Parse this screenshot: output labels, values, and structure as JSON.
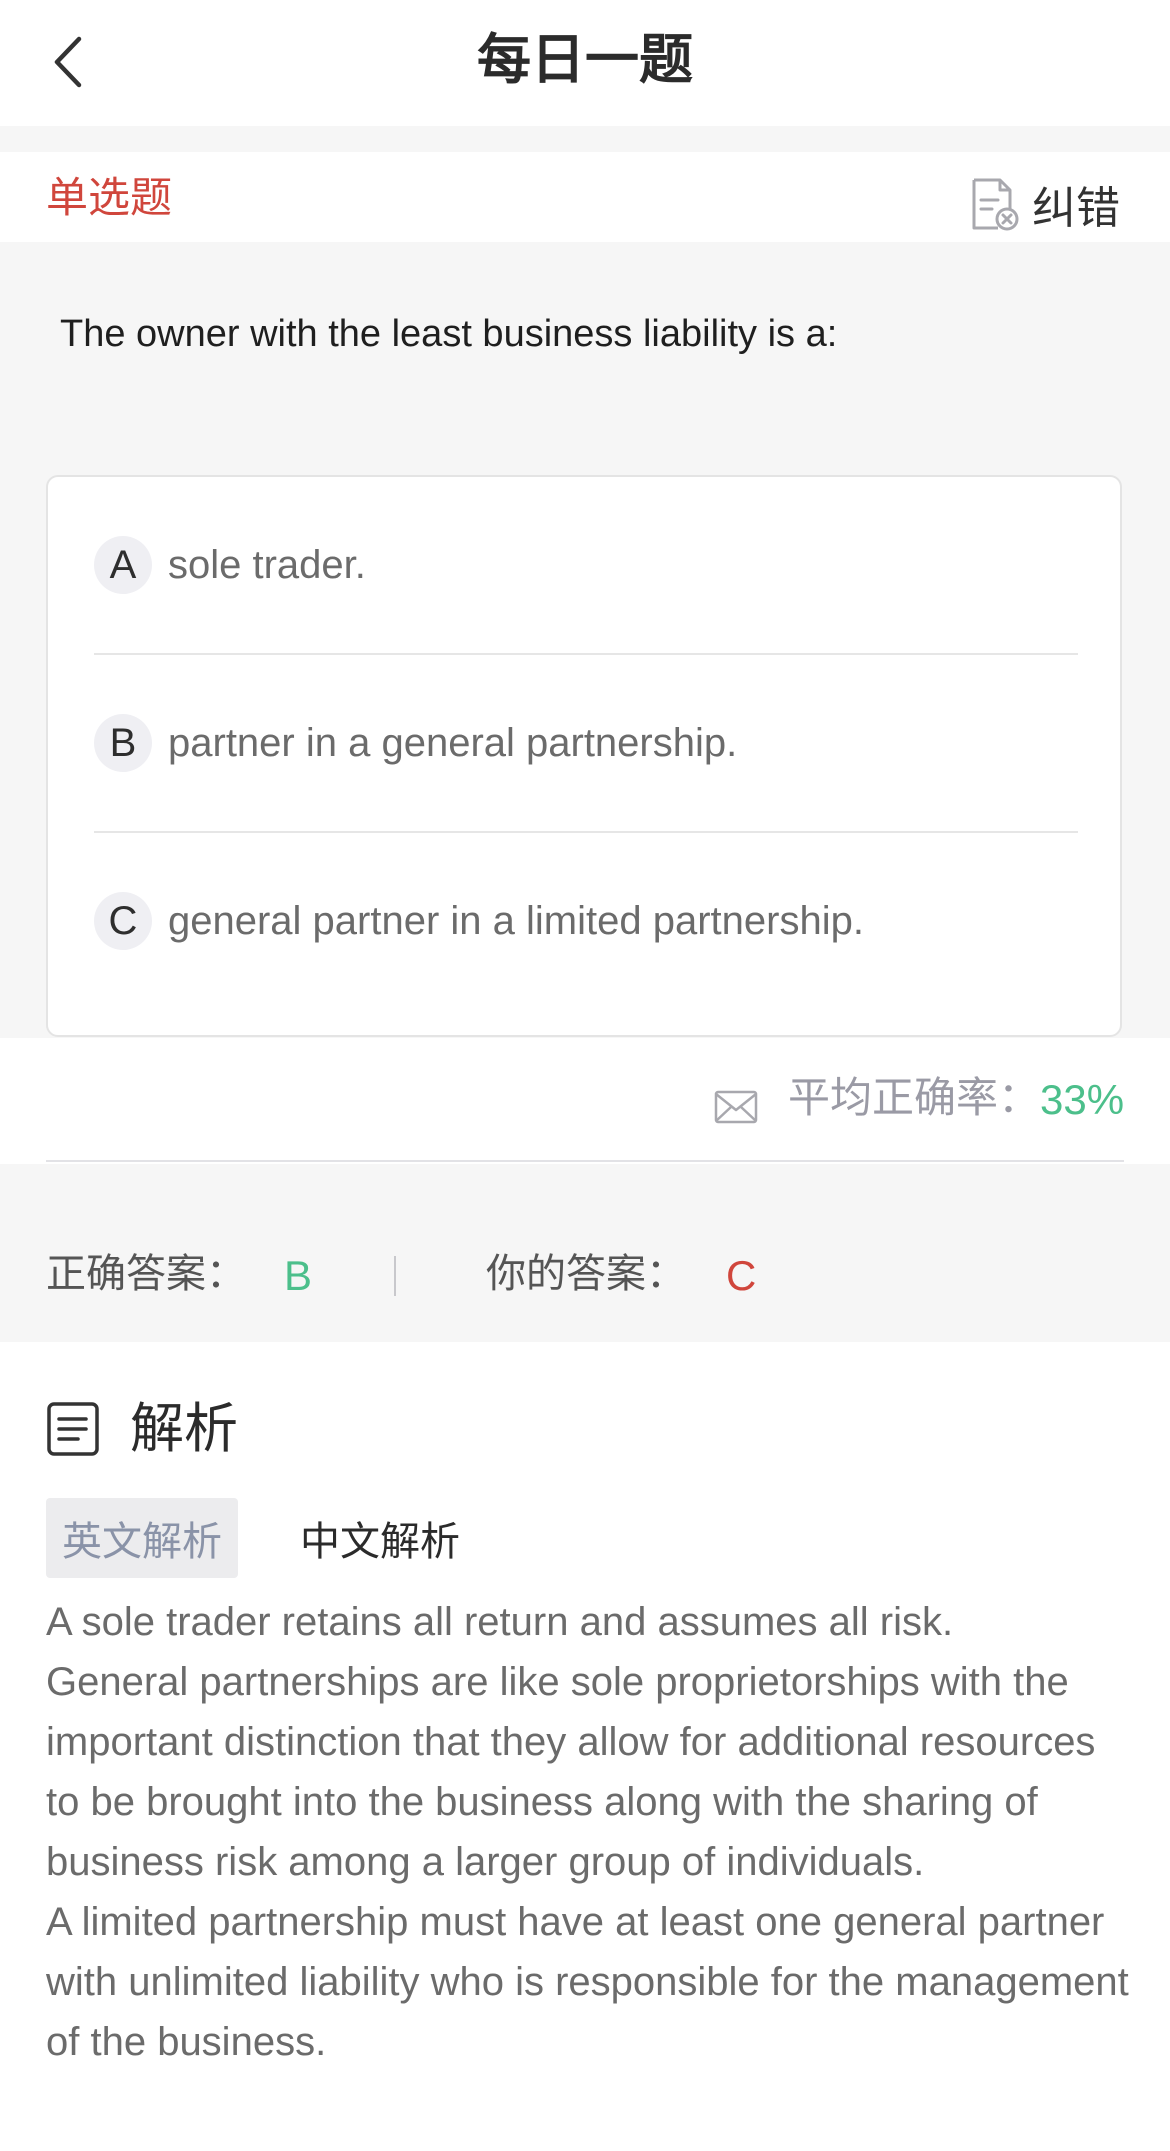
{
  "header": {
    "title": "每日一题",
    "back_icon": "chevron-left-icon"
  },
  "question": {
    "type_label": "单选题",
    "report_label": "纠错",
    "report_icon": "document-error-icon",
    "text": "The owner with the least business liability is a:",
    "options": [
      {
        "letter": "A",
        "text": "sole trader."
      },
      {
        "letter": "B",
        "text": "partner in a general partnership."
      },
      {
        "letter": "C",
        "text": "general partner in a limited partnership."
      }
    ]
  },
  "stats": {
    "accuracy_label": "平均正确率：",
    "accuracy_value": "33%",
    "icon": "mail-icon"
  },
  "answers": {
    "correct_label": "正确答案：",
    "correct_value": "B",
    "yours_label": "你的答案：",
    "yours_value": "C"
  },
  "analysis": {
    "title": "解析",
    "icon": "document-lines-icon",
    "tabs": [
      "英文解析",
      "中文解析"
    ],
    "active_tab": "英文解析",
    "paragraphs": [
      "A sole trader retains all return and assumes all risk.",
      "General partnerships are like sole proprietorships with the important distinction that they allow for additional resources to be brought into the business along with the sharing of business risk among a larger group of individuals.",
      "A limited partnership must have at least one general partner with unlimited liability who is responsible for the management of the business."
    ]
  },
  "colors": {
    "accent_red": "#d0463c",
    "accent_green": "#4cbf8b",
    "page_gray": "#f6f6f6"
  }
}
